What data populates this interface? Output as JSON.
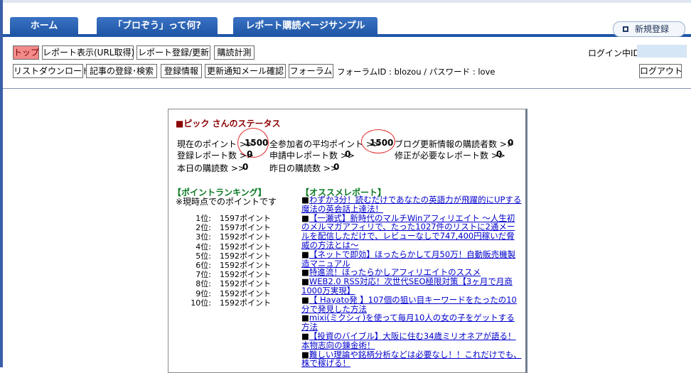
{
  "nav": {
    "tabs": [
      "ホーム",
      "「ブロぞう」って何?",
      "レポート購読ページサンプル"
    ],
    "signup_label": "新規登録"
  },
  "menu": {
    "row1": [
      "トップ",
      "レポート表示(URL取得)",
      "レポート登録/更新",
      "購読計測"
    ],
    "row2": [
      "リストダウンロード",
      "記事の登録･検索",
      "登録情報",
      "更新通知メール確認",
      "フォーラム"
    ],
    "forum_info": "フォーラムID : blozou / パスワード : love",
    "login_label": "ログイン中ID:",
    "logout_label": "ログアウト"
  },
  "status": {
    "title": "■ピック さんのステータス",
    "current_points_label": "現在のポイント >>",
    "current_points": "1500",
    "avg_points_label": "全参加者の平均ポイント >>",
    "avg_points": "1500",
    "subscribers_label": "ブログ更新情報の購読者数 >>",
    "subscribers": "0",
    "reports_label": "登録レポート数 >>",
    "reports": "0",
    "pending_label": "申請中レポート数 >>",
    "pending": "0",
    "needfix_label": "修正が必要なレポート数 >>",
    "needfix": "0",
    "today_label": "本日の購読数 >>",
    "today": "0",
    "yesterday_label": "昨日の購読数 >>",
    "yesterday": "0"
  },
  "ranking": {
    "title": "【ポイントランキング】",
    "note": "※現時点でのポイントです",
    "rows": [
      {
        "rank": "1位:",
        "points": "1597ポイント"
      },
      {
        "rank": "2位:",
        "points": "1597ポイント"
      },
      {
        "rank": "3位:",
        "points": "1592ポイント"
      },
      {
        "rank": "4位:",
        "points": "1592ポイント"
      },
      {
        "rank": "5位:",
        "points": "1592ポイント"
      },
      {
        "rank": "6位:",
        "points": "1592ポイント"
      },
      {
        "rank": "7位:",
        "points": "1592ポイント"
      },
      {
        "rank": "8位:",
        "points": "1592ポイント"
      },
      {
        "rank": "9位:",
        "points": "1592ポイント"
      },
      {
        "rank": "10位:",
        "points": "1592ポイント"
      }
    ]
  },
  "recommend": {
    "title": "【オススメレポート】",
    "items": [
      "わずか3分！読むだけであなたの英語力が飛躍的にUPする魔法の英会話上達法！",
      "【一瀬式】新時代のマルチWinアフィリエイト ～人生初のメルマガアフィリで、たった1027件のリストに2通メールを配信しただけで、レビューなしで747,400円稼いだ脅威の方法とは～",
      "【ネットで即効】ほったらかして月50万！自動販売機製造マニュアル",
      "特進流！ほったらかしアフィリエイトのススメ",
      "WEB2.0 RSS対応！次世代SEO極限対策【3ヶ月で月商1000万実現】",
      "【 Hayato発 】107個の狙い目キーワードをたったの10分で発見した方法",
      "mixi(ミクシィ)を使って毎月10人の女の子をゲットする方法",
      "【投資のバイブル】大阪に住む34歳ミリオネアが語る！本物志向の錬金術！",
      "難しい理論や銘柄分析などは必要なし！！これだけでも、株で稼げる！"
    ]
  }
}
